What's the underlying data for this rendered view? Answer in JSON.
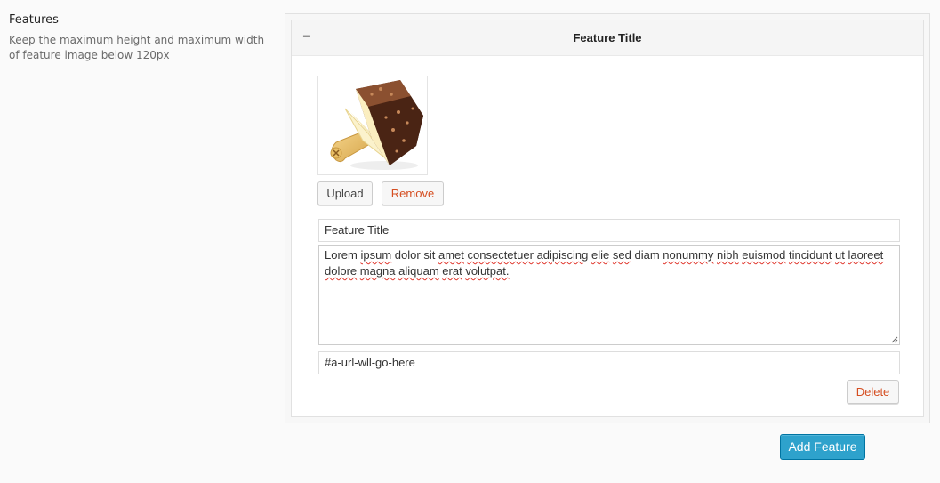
{
  "section": {
    "heading": "Features",
    "description": "Keep the maximum height and maximum width of feature image below 120px"
  },
  "feature": {
    "collapse_symbol": "−",
    "header_title": "Feature Title",
    "image_icon": "ice-cream-bar-image",
    "upload_label": "Upload",
    "remove_label": "Remove",
    "title_value": "Feature Title",
    "description_words": [
      "Lorem",
      "ipsum",
      "dolor",
      "sit",
      "amet",
      "consectetuer",
      "adipiscing",
      "elie",
      "sed",
      "diam",
      "nonummy",
      "nibh",
      "euismod",
      "tincidunt",
      "ut",
      "laoreet",
      "dolore",
      "magna",
      "aliquam",
      "erat",
      "volutpat."
    ],
    "description_misspelled": [
      false,
      true,
      false,
      false,
      true,
      true,
      true,
      true,
      true,
      false,
      true,
      true,
      true,
      true,
      true,
      true,
      true,
      true,
      true,
      true,
      true
    ],
    "url_value": "#a-url-wll-go-here",
    "delete_label": "Delete"
  },
  "add_feature_label": "Add Feature",
  "colors": {
    "primary_button": "#2ea2cc",
    "danger_text": "#d54e21",
    "spellcheck_underline": "#e0362c"
  }
}
